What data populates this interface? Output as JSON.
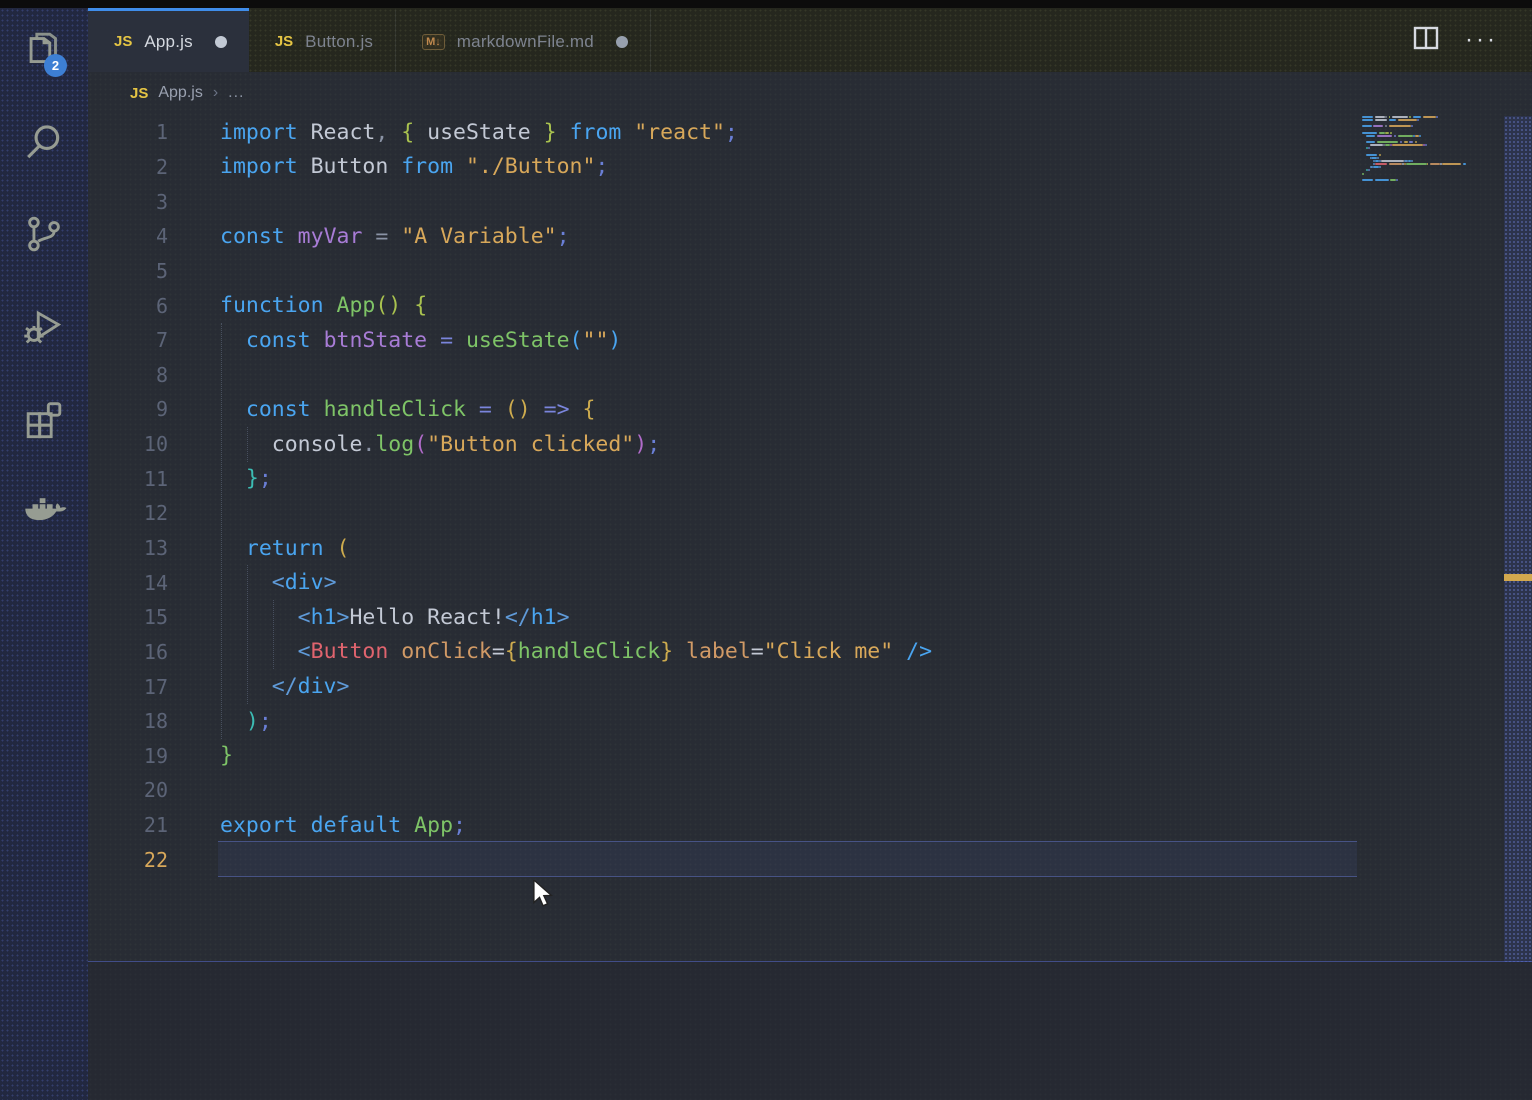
{
  "activity_bar": {
    "badge_count": "2",
    "items": [
      {
        "icon": "files-explorer-icon",
        "has_badge": true
      },
      {
        "icon": "search-icon",
        "has_badge": false
      },
      {
        "icon": "source-control-icon",
        "has_badge": false
      },
      {
        "icon": "run-debug-icon",
        "has_badge": false
      },
      {
        "icon": "extensions-icon",
        "has_badge": false
      },
      {
        "icon": "docker-icon",
        "has_badge": false
      }
    ]
  },
  "tabs": [
    {
      "label": "App.js",
      "icon": "js-file-icon",
      "icon_text": "JS",
      "active": true,
      "modified_dot": "white"
    },
    {
      "label": "Button.js",
      "icon": "js-file-icon",
      "icon_text": "JS",
      "active": false,
      "modified_dot": null
    },
    {
      "label": "markdownFile.md",
      "icon": "markdown-file-icon",
      "icon_text": "M↓",
      "active": false,
      "modified_dot": "gray"
    }
  ],
  "tab_actions": {
    "split_editor_icon": "split-editor-icon",
    "more_actions_label": "···"
  },
  "breadcrumb": {
    "icon_text": "JS",
    "file": "App.js",
    "separator": "›",
    "more": "..."
  },
  "editor": {
    "active_line": 22,
    "palette": {
      "kw": "#4aa5f0",
      "fg": "#c3c9d5",
      "pun": "#8a93a5",
      "var": "#a87cd6",
      "str": "#d8a85a",
      "grn": "#7ec467",
      "grn2": "#a9c24f",
      "gld": "#cdab4e",
      "blu": "#4aa5f0",
      "pur": "#b06bc9",
      "teal": "#3cbcb4",
      "op": "#7a85dc",
      "semi": "#6a7fd6",
      "tag": "#4aa5f0",
      "tagpun": "#5f9ad8",
      "red": "#e0646e",
      "attr": "#d19a66",
      "sp": "transparent"
    },
    "lines": [
      {
        "num": 1,
        "tokens": [
          [
            "import",
            "kw"
          ],
          [
            " React",
            "fg"
          ],
          [
            ",",
            "pun"
          ],
          [
            " ",
            "sp"
          ],
          [
            "{",
            "grn2"
          ],
          [
            " useState ",
            "fg"
          ],
          [
            "}",
            "grn2"
          ],
          [
            " ",
            "sp"
          ],
          [
            "from",
            "kw"
          ],
          [
            " ",
            "sp"
          ],
          [
            "\"react\"",
            "str"
          ],
          [
            ";",
            "semi"
          ]
        ]
      },
      {
        "num": 2,
        "tokens": [
          [
            "import",
            "kw"
          ],
          [
            " Button ",
            "fg"
          ],
          [
            "from",
            "kw"
          ],
          [
            " ",
            "sp"
          ],
          [
            "\"./Button\"",
            "str"
          ],
          [
            ";",
            "semi"
          ]
        ]
      },
      {
        "num": 3,
        "tokens": []
      },
      {
        "num": 4,
        "tokens": [
          [
            "const",
            "kw"
          ],
          [
            " myVar ",
            "var"
          ],
          [
            "=",
            "pun"
          ],
          [
            " ",
            "sp"
          ],
          [
            "\"A Variable\"",
            "str"
          ],
          [
            ";",
            "semi"
          ]
        ]
      },
      {
        "num": 5,
        "tokens": []
      },
      {
        "num": 6,
        "tokens": [
          [
            "function",
            "kw"
          ],
          [
            " App",
            "grn"
          ],
          [
            "()",
            "grn2"
          ],
          [
            " ",
            "sp"
          ],
          [
            "{",
            "grn2"
          ]
        ]
      },
      {
        "num": 7,
        "tokens": [
          [
            "  ",
            "sp"
          ],
          [
            "const",
            "kw"
          ],
          [
            " btnState ",
            "var"
          ],
          [
            "=",
            "op"
          ],
          [
            " ",
            "sp"
          ],
          [
            "useState",
            "grn"
          ],
          [
            "(",
            "blu"
          ],
          [
            "\"\"",
            "str"
          ],
          [
            ")",
            "blu"
          ]
        ]
      },
      {
        "num": 8,
        "tokens": []
      },
      {
        "num": 9,
        "tokens": [
          [
            "  ",
            "sp"
          ],
          [
            "const",
            "kw"
          ],
          [
            " handleClick ",
            "grn"
          ],
          [
            "=",
            "op"
          ],
          [
            " ",
            "sp"
          ],
          [
            "()",
            "gld"
          ],
          [
            " ",
            "sp"
          ],
          [
            "=>",
            "op"
          ],
          [
            " ",
            "sp"
          ],
          [
            "{",
            "gld"
          ]
        ]
      },
      {
        "num": 10,
        "tokens": [
          [
            "    ",
            "sp"
          ],
          [
            "console",
            "fg"
          ],
          [
            ".",
            "pun"
          ],
          [
            "log",
            "grn"
          ],
          [
            "(",
            "pur"
          ],
          [
            "\"Button clicked\"",
            "str"
          ],
          [
            ")",
            "pur"
          ],
          [
            ";",
            "semi"
          ]
        ]
      },
      {
        "num": 11,
        "tokens": [
          [
            "  ",
            "sp"
          ],
          [
            "}",
            "teal"
          ],
          [
            ";",
            "semi"
          ]
        ]
      },
      {
        "num": 12,
        "tokens": []
      },
      {
        "num": 13,
        "tokens": [
          [
            "  ",
            "sp"
          ],
          [
            "return",
            "kw"
          ],
          [
            " ",
            "sp"
          ],
          [
            "(",
            "gld"
          ]
        ]
      },
      {
        "num": 14,
        "tokens": [
          [
            "    ",
            "sp"
          ],
          [
            "<",
            "tagpun"
          ],
          [
            "div",
            "tag"
          ],
          [
            ">",
            "tagpun"
          ]
        ]
      },
      {
        "num": 15,
        "tokens": [
          [
            "      ",
            "sp"
          ],
          [
            "<",
            "tagpun"
          ],
          [
            "h1",
            "tag"
          ],
          [
            ">",
            "tagpun"
          ],
          [
            "Hello React!",
            "fg"
          ],
          [
            "</",
            "tagpun"
          ],
          [
            "h1",
            "tag"
          ],
          [
            ">",
            "tagpun"
          ]
        ]
      },
      {
        "num": 16,
        "tokens": [
          [
            "      ",
            "sp"
          ],
          [
            "<",
            "tagpun"
          ],
          [
            "Button",
            "red"
          ],
          [
            " onClick",
            "attr"
          ],
          [
            "=",
            "fg"
          ],
          [
            "{",
            "gld"
          ],
          [
            "handleClick",
            "grn"
          ],
          [
            "}",
            "gld"
          ],
          [
            " label",
            "attr"
          ],
          [
            "=",
            "fg"
          ],
          [
            "\"Click me\"",
            "str"
          ],
          [
            " ",
            "sp"
          ],
          [
            "/>",
            "blu"
          ]
        ]
      },
      {
        "num": 17,
        "tokens": [
          [
            "    ",
            "sp"
          ],
          [
            "</",
            "tagpun"
          ],
          [
            "div",
            "tag"
          ],
          [
            ">",
            "tagpun"
          ]
        ]
      },
      {
        "num": 18,
        "tokens": [
          [
            "  ",
            "sp"
          ],
          [
            ")",
            "teal"
          ],
          [
            ";",
            "semi"
          ]
        ]
      },
      {
        "num": 19,
        "tokens": [
          [
            "}",
            "grn"
          ]
        ]
      },
      {
        "num": 20,
        "tokens": []
      },
      {
        "num": 21,
        "tokens": [
          [
            "export",
            "kw"
          ],
          [
            " ",
            "sp"
          ],
          [
            "default",
            "kw"
          ],
          [
            " App",
            "grn"
          ],
          [
            ";",
            "semi"
          ]
        ]
      },
      {
        "num": 22,
        "tokens": []
      }
    ]
  },
  "overview_ruler": {
    "marker_color": "#d2a84e"
  }
}
